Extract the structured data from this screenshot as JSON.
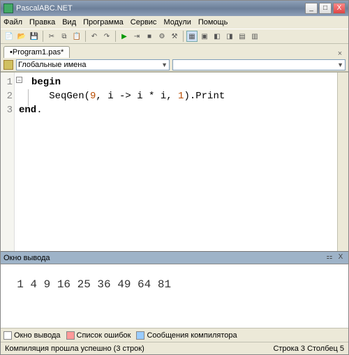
{
  "window": {
    "title": "PascalABC.NET",
    "min": "_",
    "max": "□",
    "close": "X"
  },
  "menu": {
    "file": "Файл",
    "edit": "Правка",
    "view": "Вид",
    "program": "Программа",
    "service": "Сервис",
    "modules": "Модули",
    "help": "Помощь"
  },
  "tab": {
    "name": "•Program1.pas*",
    "close": "×"
  },
  "scope": {
    "label": "Глобальные имена",
    "arrow": "▼"
  },
  "code": {
    "lines": [
      "1",
      "2",
      "3"
    ],
    "begin": "begin",
    "end": "end",
    "dot": ".",
    "l2a": "   SeqGen(",
    "n9": "9",
    "l2b": ", i -> i * i, ",
    "n1": "1",
    "l2c": ").Print",
    "fold": "−"
  },
  "outputPanel": {
    "title": "Окно вывода",
    "pin": "⚏",
    "close": "X",
    "text": "1 4 9 16 25 36 49 64 81"
  },
  "bottomTabs": {
    "output": "Окно вывода",
    "errors": "Список ошибок",
    "messages": "Сообщения компилятора"
  },
  "status": {
    "left": "Компиляция прошла успешно (3 строк)",
    "right": "Строка  3  Столбец  5"
  }
}
